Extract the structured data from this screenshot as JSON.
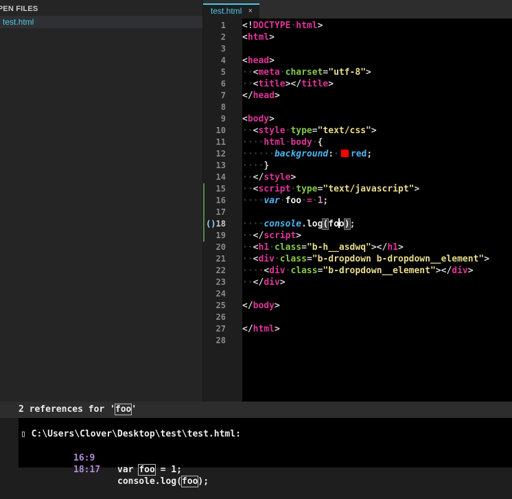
{
  "sidebar": {
    "section_title": "OPEN FILES",
    "files": [
      {
        "name": "test.html",
        "active": true
      }
    ]
  },
  "tabs": [
    {
      "label": "test.html",
      "close": "×"
    }
  ],
  "editor": {
    "line_numbers": [
      "1",
      "2",
      "3",
      "4",
      "5",
      "6",
      "7",
      "8",
      "9",
      "10",
      "11",
      "12",
      "13",
      "14",
      "15",
      "16",
      "17",
      "18",
      "19",
      "20",
      "21",
      "22",
      "23",
      "24",
      "25",
      "26",
      "27",
      "28"
    ],
    "current_line": 18,
    "current_line_marker": "()",
    "lines": [
      [
        [
          "t-punc",
          "<!"
        ],
        [
          "t-tag",
          "DOCTYPE"
        ],
        [
          "dot",
          "·"
        ],
        [
          "t-tag",
          "html"
        ],
        [
          "t-punc",
          ">"
        ]
      ],
      [
        [
          "t-punc",
          "<"
        ],
        [
          "t-tag",
          "html"
        ],
        [
          "t-punc",
          ">"
        ]
      ],
      [],
      [
        [
          "t-punc",
          "<"
        ],
        [
          "t-tag",
          "head"
        ],
        [
          "t-punc",
          ">"
        ]
      ],
      [
        [
          "dot",
          "··"
        ],
        [
          "t-punc",
          "<"
        ],
        [
          "t-tag",
          "meta"
        ],
        [
          "dot",
          "·"
        ],
        [
          "t-attr",
          "charset"
        ],
        [
          "t-punc",
          "="
        ],
        [
          "t-str",
          "\"utf-8\""
        ],
        [
          "t-punc",
          ">"
        ]
      ],
      [
        [
          "dot",
          "··"
        ],
        [
          "t-punc",
          "<"
        ],
        [
          "t-tag",
          "title"
        ],
        [
          "t-punc",
          "></"
        ],
        [
          "t-tag",
          "title"
        ],
        [
          "t-punc",
          ">"
        ]
      ],
      [
        [
          "t-punc",
          "</"
        ],
        [
          "t-tag",
          "head"
        ],
        [
          "t-punc",
          ">"
        ]
      ],
      [],
      [
        [
          "t-punc",
          "<"
        ],
        [
          "t-tag",
          "body"
        ],
        [
          "t-punc",
          ">"
        ]
      ],
      [
        [
          "dot",
          "··"
        ],
        [
          "t-punc",
          "<"
        ],
        [
          "t-tag",
          "style"
        ],
        [
          "dot",
          "·"
        ],
        [
          "t-attr",
          "type"
        ],
        [
          "t-punc",
          "="
        ],
        [
          "t-str",
          "\"text/css\""
        ],
        [
          "t-punc",
          ">"
        ]
      ],
      [
        [
          "dot",
          "····"
        ],
        [
          "t-sel",
          "html"
        ],
        [
          "dot",
          "·"
        ],
        [
          "t-sel",
          "body"
        ],
        [
          "dot",
          "·"
        ],
        [
          "t-punc",
          "{"
        ]
      ],
      [
        [
          "dot",
          "······"
        ],
        [
          "t-kw",
          "background"
        ],
        [
          "t-punc",
          ":"
        ],
        [
          "dot",
          "·"
        ],
        [
          "swatch",
          "#ff0000"
        ],
        [
          "t-kw-plain",
          "red"
        ],
        [
          "t-punc",
          ";"
        ]
      ],
      [
        [
          "dot",
          "····"
        ],
        [
          "t-punc",
          "}"
        ]
      ],
      [
        [
          "dot",
          "··"
        ],
        [
          "t-punc",
          "</"
        ],
        [
          "t-tag",
          "style"
        ],
        [
          "t-punc",
          ">"
        ]
      ],
      [
        [
          "dot",
          "··"
        ],
        [
          "t-punc",
          "<"
        ],
        [
          "t-tag",
          "script"
        ],
        [
          "dot",
          "·"
        ],
        [
          "t-attr",
          "type"
        ],
        [
          "t-punc",
          "="
        ],
        [
          "t-str",
          "\"text/javascript\""
        ],
        [
          "t-punc",
          ">"
        ]
      ],
      [
        [
          "dot",
          "····"
        ],
        [
          "t-kw",
          "var"
        ],
        [
          "dot",
          "·"
        ],
        [
          "t-plain",
          "foo"
        ],
        [
          "dot",
          "·"
        ],
        [
          "t-op",
          "="
        ],
        [
          "dot",
          "·"
        ],
        [
          "t-num",
          "1"
        ],
        [
          "t-punc",
          ";"
        ]
      ],
      [],
      [
        [
          "dot",
          "····"
        ],
        [
          "t-kw",
          "console"
        ],
        [
          "t-punc",
          "."
        ],
        [
          "t-plain",
          "log"
        ],
        [
          "ref-open",
          "("
        ],
        [
          "t-plain",
          "fo"
        ],
        [
          "cursor",
          ""
        ],
        [
          "t-plain",
          "o"
        ],
        [
          "ref-close",
          ")"
        ],
        [
          "t-punc",
          ";"
        ]
      ],
      [
        [
          "dot",
          "··"
        ],
        [
          "t-punc",
          "</"
        ],
        [
          "t-tag",
          "script"
        ],
        [
          "t-punc",
          ">"
        ]
      ],
      [
        [
          "dot",
          "··"
        ],
        [
          "t-punc",
          "<"
        ],
        [
          "t-tag",
          "h1"
        ],
        [
          "dot",
          "·"
        ],
        [
          "t-attr",
          "class"
        ],
        [
          "t-punc",
          "="
        ],
        [
          "t-str",
          "\"b-h__asdwq\""
        ],
        [
          "t-punc",
          "></"
        ],
        [
          "t-tag",
          "h1"
        ],
        [
          "t-punc",
          ">"
        ]
      ],
      [
        [
          "dot",
          "··"
        ],
        [
          "t-punc",
          "<"
        ],
        [
          "t-tag",
          "div"
        ],
        [
          "dot",
          "·"
        ],
        [
          "t-attr",
          "class"
        ],
        [
          "t-punc",
          "="
        ],
        [
          "t-str",
          "\"b-dropdown b-dropdown__element\""
        ],
        [
          "t-punc",
          ">"
        ]
      ],
      [
        [
          "dot",
          "····"
        ],
        [
          "t-punc",
          "<"
        ],
        [
          "t-tag",
          "div"
        ],
        [
          "dot",
          "·"
        ],
        [
          "t-attr",
          "class"
        ],
        [
          "t-punc",
          "="
        ],
        [
          "t-str",
          "\"b-dropdown__element\""
        ],
        [
          "t-punc",
          "></"
        ],
        [
          "t-tag",
          "div"
        ],
        [
          "t-punc",
          ">"
        ]
      ],
      [
        [
          "dot",
          "··"
        ],
        [
          "t-punc",
          "</"
        ],
        [
          "t-tag",
          "div"
        ],
        [
          "t-punc",
          ">"
        ]
      ],
      [],
      [
        [
          "t-punc",
          "</"
        ],
        [
          "t-tag",
          "body"
        ],
        [
          "t-punc",
          ">"
        ]
      ],
      [],
      [
        [
          "t-punc",
          "</"
        ],
        [
          "t-tag",
          "html"
        ],
        [
          "t-punc",
          ">"
        ]
      ],
      []
    ]
  },
  "references_panel": {
    "title_prefix": "2 references for '",
    "symbol": "foo",
    "title_suffix": "'",
    "file_glyph": "▯",
    "file_path": "C:\\Users\\Clover\\Desktop\\test\\test.html:",
    "results": [
      {
        "location": "16:9",
        "before": "var ",
        "match": "foo",
        "after": " = 1;"
      },
      {
        "location": "18:17",
        "before": "console.log(",
        "match": "foo",
        "after": ");"
      }
    ]
  },
  "colors": {
    "accent": "#4ec9e6",
    "tag": "#e0339a",
    "attribute": "#88c84a",
    "string": "#e8dc8c",
    "keyword": "#4db7f0",
    "git_added": "#4e8f4e"
  }
}
